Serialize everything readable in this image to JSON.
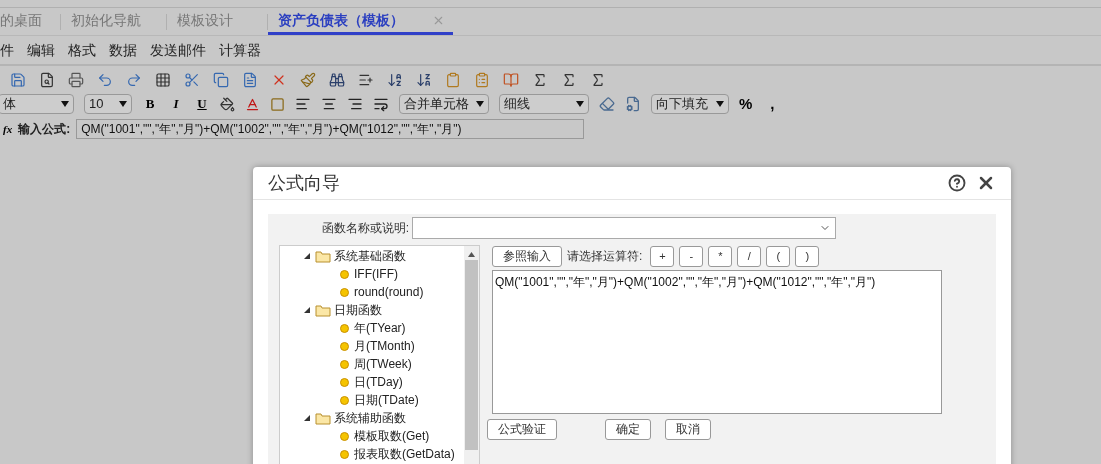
{
  "tabs": [
    {
      "label": "的桌面",
      "selected": false,
      "closable": false
    },
    {
      "label": "初始化导航",
      "selected": false,
      "closable": false
    },
    {
      "label": "模板设计",
      "selected": false,
      "closable": false
    },
    {
      "label": "资产负债表（模板）",
      "selected": true,
      "closable": true
    }
  ],
  "menu": [
    "件",
    "编辑",
    "格式",
    "数据",
    "发送邮件",
    "计算器"
  ],
  "format_bar": {
    "font": "体",
    "size": "10",
    "bold": "B",
    "italic": "I",
    "underline": "U",
    "merge": "合并单元格",
    "line": "细线",
    "fill": "向下填充",
    "percent": "%",
    "comma": ","
  },
  "formula_bar": {
    "icon": "fx",
    "label": "输入公式:",
    "value": "QM(\"1001\",\"\",\"年\",\"月\")+QM(\"1002\",\"\",\"年\",\"月\")+QM(\"1012\",\"\",\"年\",\"月\")"
  },
  "dialog": {
    "title": "公式向导",
    "search_label": "函数名称或说明:",
    "tree": [
      {
        "label": "系统基础函数",
        "expanded": true,
        "children": [
          {
            "label": "IFF(IFF)"
          },
          {
            "label": "round(round)"
          }
        ]
      },
      {
        "label": "日期函数",
        "expanded": true,
        "children": [
          {
            "label": "年(TYear)"
          },
          {
            "label": "月(TMonth)"
          },
          {
            "label": "周(TWeek)"
          },
          {
            "label": "日(TDay)"
          },
          {
            "label": "日期(TDate)"
          }
        ]
      },
      {
        "label": "系统辅助函数",
        "expanded": true,
        "children": [
          {
            "label": "模板取数(Get)"
          },
          {
            "label": "报表取数(GetData)"
          }
        ]
      }
    ],
    "reference_button": "参照输入",
    "operator_label": "请选择运算符:",
    "operators": [
      "+",
      "-",
      "*",
      "/",
      "(",
      ")"
    ],
    "formula": "QM(\"1001\",\"\",\"年\",\"月\")+QM(\"1002\",\"\",\"年\",\"月\")+QM(\"1012\",\"\",\"年\",\"月\")",
    "buttons": [
      "公式验证",
      "确定",
      "取消"
    ]
  }
}
